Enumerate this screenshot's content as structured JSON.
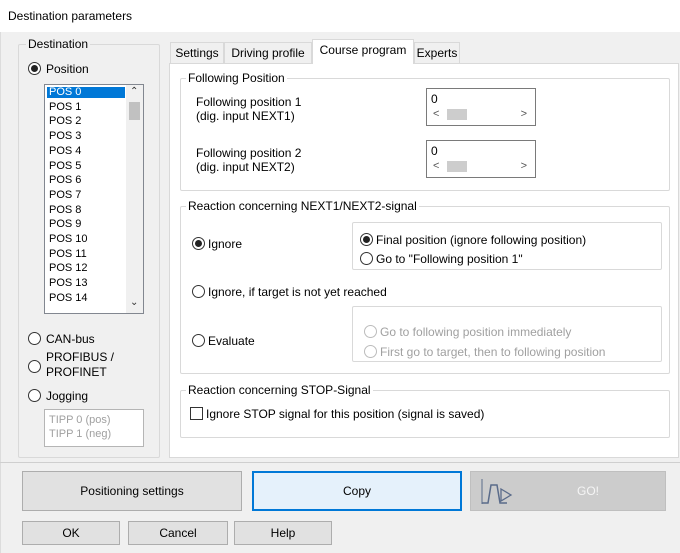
{
  "window": {
    "title": "Destination parameters"
  },
  "destination": {
    "label": "Destination",
    "position_label": "Position",
    "canbus_label": "CAN-bus",
    "profibus_label_line1": "PROFIBUS /",
    "profibus_label_line2": "PROFINET",
    "jogging_label": "Jogging",
    "positions": [
      "POS 0",
      "POS 1",
      "POS 2",
      "POS 3",
      "POS 4",
      "POS 5",
      "POS 6",
      "POS 7",
      "POS 8",
      "POS 9",
      "POS 10",
      "POS 11",
      "POS 12",
      "POS 13",
      "POS 14"
    ],
    "selected_position": "POS 0",
    "jogging_items": [
      "TIPP 0 (pos)",
      "TIPP 1 (neg)"
    ]
  },
  "tabs": [
    {
      "label": "Settings"
    },
    {
      "label": "Driving profile"
    },
    {
      "label": "Course program"
    },
    {
      "label": "Experts"
    }
  ],
  "course_program": {
    "following_position": {
      "label": "Following Position",
      "pos1_line1": "Following position 1",
      "pos1_line2": "(dig. input NEXT1)",
      "pos1_value": "0",
      "pos2_line1": "Following position 2",
      "pos2_line2": "(dig. input NEXT2)",
      "pos2_value": "0"
    },
    "reaction_next": {
      "label": "Reaction concerning NEXT1/NEXT2-signal",
      "ignore": "Ignore",
      "final_position": "Final position (ignore following position)",
      "goto_following1": "Go to \"Following position 1\"",
      "ignore_if_not_reached": "Ignore, if target is not yet reached",
      "evaluate": "Evaluate",
      "goto_immediately": "Go to following position immediately",
      "first_target_then": "First go to target, then to following position"
    },
    "reaction_stop": {
      "label": "Reaction concerning STOP-Signal",
      "ignore_stop": "Ignore STOP signal for this position (signal is saved)"
    }
  },
  "buttons": {
    "positioning_settings": "Positioning settings",
    "copy": "Copy",
    "go": "GO!",
    "ok": "OK",
    "cancel": "Cancel",
    "help": "Help"
  },
  "icons": {
    "scroll_up": "chevron-up-icon",
    "scroll_down": "chevron-down-icon",
    "go_graph": "motion-profile-icon"
  }
}
